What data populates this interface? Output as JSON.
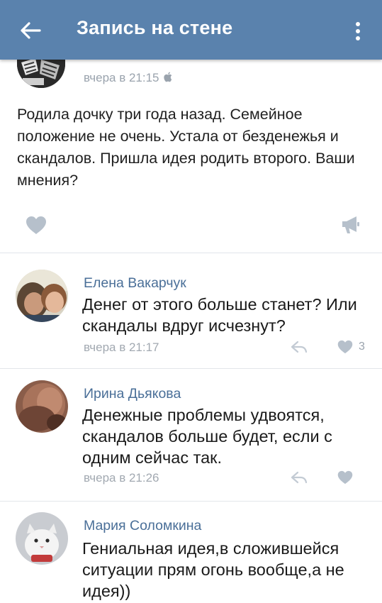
{
  "header": {
    "title": "Запись на стене",
    "back_icon": "arrow-left-icon",
    "menu_icon": "more-vertical-icon",
    "background": "#5a82ad"
  },
  "post": {
    "time": "вчера в 21:15",
    "platform_icon": "apple-icon",
    "text": "Родила дочку три года назад. Семейное положение не очень. Устала от безденежья и скандалов. Пришла идея родить второго. Ваши мнения?",
    "like_icon": "heart-icon",
    "share_icon": "megaphone-icon"
  },
  "comments": [
    {
      "author": "Елена Вакарчук",
      "text": "Денег от этого больше станет? Или скандалы вдруг исчезнут?",
      "time": "вчера в 21:17",
      "likes": "3"
    },
    {
      "author": "Ирина Дьякова",
      "text": "Денежные проблемы удвоятся, скандалов больше будет, если с одним сейчас так.",
      "time": "вчера в 21:26",
      "likes": ""
    },
    {
      "author": "Мария Соломкина",
      "text": "Гениальная идея,в сложившейся ситуации прям огонь вообще,а не идея))",
      "time": "",
      "likes": ""
    }
  ],
  "colors": {
    "accent": "#5a82ad",
    "author_name": "#4a6f98",
    "meta_gray": "#a2a9b1",
    "icon_gray": "#b6c0cb"
  }
}
